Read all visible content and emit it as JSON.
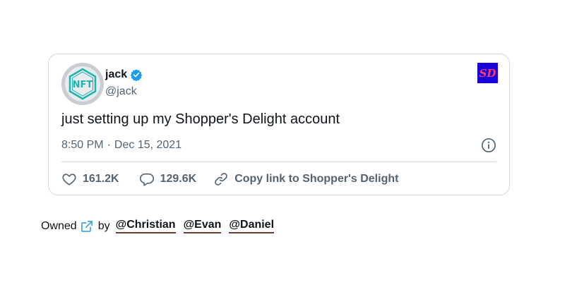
{
  "tweet": {
    "display_name": "jack",
    "handle": "@jack",
    "text": "just setting up my Shopper's Delight account",
    "time": "8:50 PM",
    "separator": "·",
    "date": "Dec 15, 2021",
    "likes": "161.2K",
    "replies": "129.6K",
    "copy_link_label": "Copy link to Shopper's Delight",
    "brand_badge": "SD",
    "avatar_letters": "NFT"
  },
  "owners": {
    "label": "Owned",
    "by_label": "by",
    "names": [
      "@Christian",
      "@Evan",
      "@Daniel"
    ]
  },
  "colors": {
    "verified": "#1d9bf0",
    "muted_text": "#536471",
    "border": "#cfd9de",
    "badge_bg": "#1a00d9",
    "badge_text": "#ff3a6e",
    "avatar_accent": "#1fb3b0",
    "link_underline": "#6b3d2e",
    "external_icon": "#3aa0e8"
  },
  "icons": {
    "verified": "verified-badge-icon",
    "info": "info-icon",
    "like": "heart-icon",
    "reply": "speech-bubble-icon",
    "link": "link-icon",
    "external": "external-link-icon"
  }
}
